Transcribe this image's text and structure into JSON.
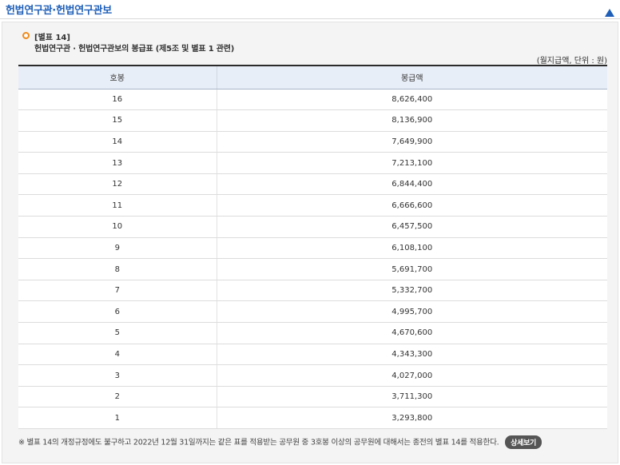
{
  "header": {
    "title": "헌법연구관·헌법연구관보",
    "collapse_icon": "triangle-up-icon",
    "accent_color": "#1f5fb8"
  },
  "section": {
    "label": "[별표 14]",
    "caption": "헌법연구관 · 헌법연구관보의 봉급표 (제5조 및 별표 1 관련)",
    "unit_note": "(월지급액, 단위 : 원)",
    "bullet_icon": "circle-bullet-icon"
  },
  "table": {
    "columns": [
      "호봉",
      "봉급액"
    ],
    "rows": [
      [
        "16",
        "8,626,400"
      ],
      [
        "15",
        "8,136,900"
      ],
      [
        "14",
        "7,649,900"
      ],
      [
        "13",
        "7,213,100"
      ],
      [
        "12",
        "6,844,400"
      ],
      [
        "11",
        "6,666,600"
      ],
      [
        "10",
        "6,457,500"
      ],
      [
        "9",
        "6,108,100"
      ],
      [
        "8",
        "5,691,700"
      ],
      [
        "7",
        "5,332,700"
      ],
      [
        "6",
        "4,995,700"
      ],
      [
        "5",
        "4,670,600"
      ],
      [
        "4",
        "4,343,300"
      ],
      [
        "3",
        "4,027,000"
      ],
      [
        "2",
        "3,711,300"
      ],
      [
        "1",
        "3,293,800"
      ]
    ]
  },
  "footnote": {
    "text": "※ 별표 14의 개정규정에도 불구하고 2022년 12월 31일까지는 같은 표를 적용받는 공무원 중 3호봉 이상의 공무원에 대해서는 종전의 별표 14를 적용한다.",
    "detail_button": "상세보기"
  }
}
